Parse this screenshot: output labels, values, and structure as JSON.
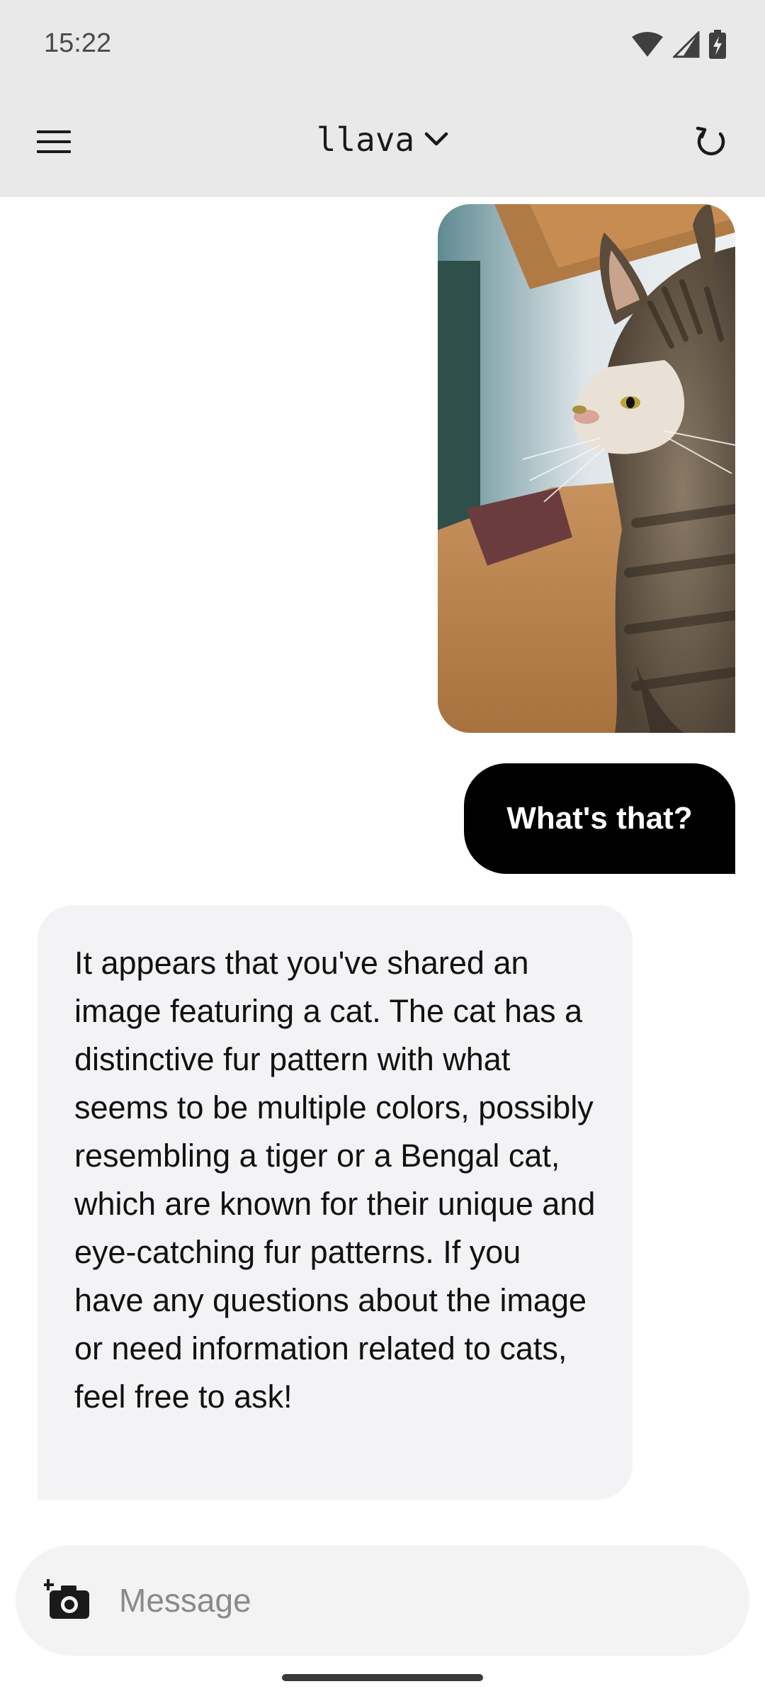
{
  "status_bar": {
    "time": "15:22"
  },
  "app_bar": {
    "title": "llava"
  },
  "conversation": {
    "user_message": "What's that?",
    "assistant_message": "It appears that you've shared an image featuring a cat. The cat has a distinctive fur pattern with what seems to be multiple colors, possibly resembling a tiger or a Bengal cat, which are known for their unique and eye-catching fur patterns. If you have any questions about the image or need information related to cats, feel free to ask!"
  },
  "composer": {
    "placeholder": "Message"
  },
  "icons": {
    "menu": "menu-icon",
    "dropdown": "chevron-down-icon",
    "refresh": "refresh-icon",
    "camera": "add-photo-camera-icon",
    "wifi": "wifi-icon",
    "signal": "cell-signal-icon",
    "battery": "battery-charging-icon"
  },
  "colors": {
    "app_bar_bg": "#e9e9e9",
    "user_bubble_bg": "#000000",
    "assistant_bubble_bg": "#f3f3f5",
    "composer_bg": "#f3f3f3"
  }
}
